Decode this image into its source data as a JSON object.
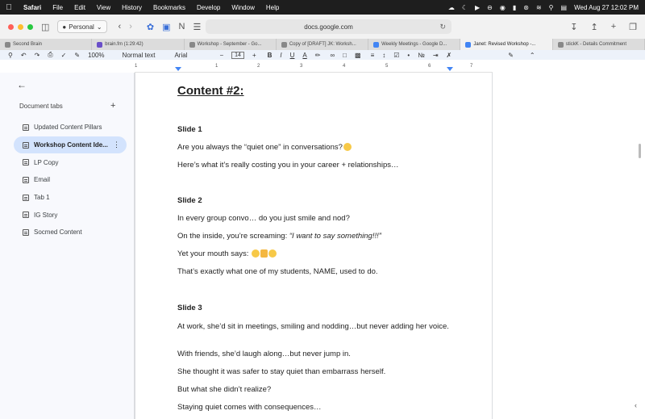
{
  "menubar": {
    "app_name": "Safari",
    "menus": [
      "File",
      "Edit",
      "View",
      "History",
      "Bookmarks",
      "Develop",
      "Window",
      "Help"
    ],
    "datetime": "Wed Aug 27  12:02 PM"
  },
  "toolbar": {
    "profile": "Personal",
    "address": "docs.google.com"
  },
  "tabs": [
    {
      "label": "Second Brain"
    },
    {
      "label": "brain.fm (1:29:42)"
    },
    {
      "label": "Workshop - September - Go..."
    },
    {
      "label": "Copy of [DRAFT] JK: Worksh..."
    },
    {
      "label": "Weekly Meetings - Google D..."
    },
    {
      "label": "Janet: Revised Workshop -..."
    },
    {
      "label": "stickK - Details Commitment"
    }
  ],
  "docs_toolbar": {
    "zoom": "100%",
    "style": "Normal text",
    "font": "Arial",
    "font_size": "14"
  },
  "ruler": {
    "ticks": [
      "1",
      "1",
      "2",
      "3",
      "4",
      "5",
      "6",
      "7"
    ]
  },
  "sidebar": {
    "title": "Document tabs",
    "items": [
      {
        "label": "Updated Content Pillars"
      },
      {
        "label": "Workshop Content Ide..."
      },
      {
        "label": "LP Copy"
      },
      {
        "label": "Email"
      },
      {
        "label": "Tab 1"
      },
      {
        "label": "IG Story"
      },
      {
        "label": "Socmed Content"
      }
    ]
  },
  "document": {
    "heading": "Content #2:",
    "slide1": {
      "title": "Slide 1",
      "line1": "Are you always the “quiet one” in conversations?",
      "line2": "Here’s what it’s really costing you in your career + relationships…"
    },
    "slide2": {
      "title": "Slide 2",
      "line1": "In every group convo… do you just smile and nod?",
      "line2_prefix": "On the inside, you’re screaming: ",
      "line2_quote": "“I want to say something!!!”",
      "line3": "Yet your mouth says: ",
      "line4": "That’s exactly what one of my students, NAME, used to do."
    },
    "slide3": {
      "title": "Slide 3",
      "line1": "At work, she’d sit in meetings, smiling and nodding…but never adding her voice.",
      "line2": "With friends, she’d laugh along…but never jump in.",
      "line3": "She thought it was safer to stay quiet than embarrass herself.",
      "line4": "But what she didn’t realize?",
      "line5": "Staying quiet comes with consequences…"
    }
  }
}
